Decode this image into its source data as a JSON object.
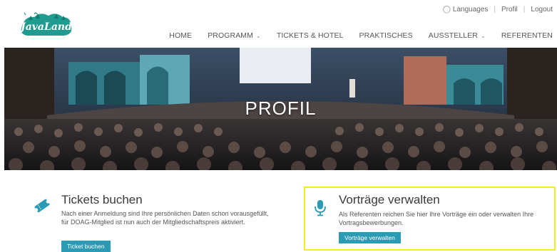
{
  "header": {
    "logo_text": "JavaLand",
    "languages_label": "Languages",
    "profile_label": "Profil",
    "logout_label": "Logout"
  },
  "nav": {
    "items": [
      {
        "label": "HOME",
        "has_caret": false
      },
      {
        "label": "PROGRAMM",
        "has_caret": true
      },
      {
        "label": "TICKETS & HOTEL",
        "has_caret": false
      },
      {
        "label": "PRAKTISCHES",
        "has_caret": false
      },
      {
        "label": "AUSSTELLER",
        "has_caret": true
      },
      {
        "label": "REFERENTEN",
        "has_caret": false
      }
    ]
  },
  "hero": {
    "title": "PROFIL"
  },
  "cards": {
    "tickets": {
      "icon": "ticket-icon",
      "heading": "Tickets buchen",
      "text": "Nach einer Anmeldung sind Ihre persönlichen Daten schon vorausgefüllt, für DOAG-Mitglied ist nun auch der Mitgliedschaftspreis aktiviert.",
      "button": "Ticket buchen"
    },
    "talks": {
      "icon": "microphone-icon",
      "heading": "Vorträge verwalten",
      "text": "Als Referenten reichen Sie hier Ihre Vorträge ein oder verwalten Ihre Vortragsbewerbungen.",
      "button": "Vorträge verwalten",
      "highlight_color": "#f2ef1c"
    }
  },
  "colors": {
    "accent": "#2a9ab5",
    "highlight": "#f2ef1c"
  }
}
